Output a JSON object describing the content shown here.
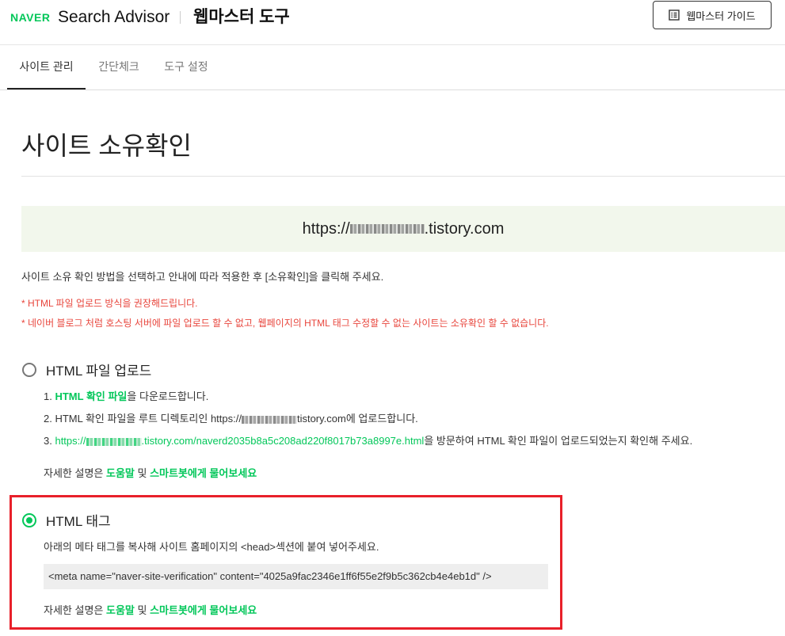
{
  "header": {
    "logo": "NAVER",
    "brand_title": "Search Advisor",
    "tool_title": "웹마스터 도구",
    "guide_button": "웹마스터 가이드"
  },
  "tabs": [
    {
      "label": "사이트 관리",
      "active": true
    },
    {
      "label": "간단체크",
      "active": false
    },
    {
      "label": "도구 설정",
      "active": false
    }
  ],
  "page": {
    "title": "사이트 소유확인",
    "url_prefix": "https://",
    "url_suffix": ".tistory.com"
  },
  "instructions": {
    "description": "사이트 소유 확인 방법을 선택하고 안내에 따라 적용한 후 [소유확인]을 클릭해 주세요.",
    "warning_1": "* HTML 파일 업로드 방식을 권장해드립니다.",
    "warning_2": "* 네이버 블로그 처럼 호스팅 서버에 파일 업로드 할 수 없고, 웹페이지의 HTML 태그 수정할 수 없는 사이트는 소유확인 할 수 없습니다."
  },
  "html_file_option": {
    "label": "HTML 파일 업로드",
    "selected": false,
    "step1_num": "1. ",
    "step1_link": "HTML 확인 파일",
    "step1_rest": "을 다운로드합니다.",
    "step2_prefix": "2. HTML 확인 파일을 루트 디렉토리인 https://",
    "step2_suffix": "tistory.com에 업로드합니다.",
    "step3_num": "3. ",
    "step3_link_prefix": "https://",
    "step3_link_suffix": ".tistory.com/naverd2035b8a5c208ad220f8017b73a8997e.html",
    "step3_rest": "을 방문하여 HTML 확인 파일이 업로드되었는지 확인해 주세요.",
    "help_prefix": "자세한 설명은 ",
    "help_link": "도움말",
    "help_and": " 및 ",
    "bot_link": "스마트봇에게 물어보세요"
  },
  "html_tag_option": {
    "label": "HTML 태그",
    "selected": true,
    "instruction": "아래의 메타 태그를 복사해 사이트 홈페이지의 <head>섹션에 붙여 넣어주세요.",
    "meta_tag": "<meta name=\"naver-site-verification\" content=\"4025a9fac2346e1ff6f55e2f9b5c362cb4e4eb1d\" />",
    "help_prefix": "자세한 설명은 ",
    "help_link": "도움말",
    "help_and": " 및 ",
    "bot_link": "스마트봇에게 물어보세요"
  },
  "colors": {
    "accent_green": "#03c75a",
    "warning_red": "#e8453c",
    "highlight_red": "#e8202a",
    "url_box_bg": "#f2f7ec"
  },
  "icons": {
    "guide_button_icon": "document-list-icon"
  }
}
